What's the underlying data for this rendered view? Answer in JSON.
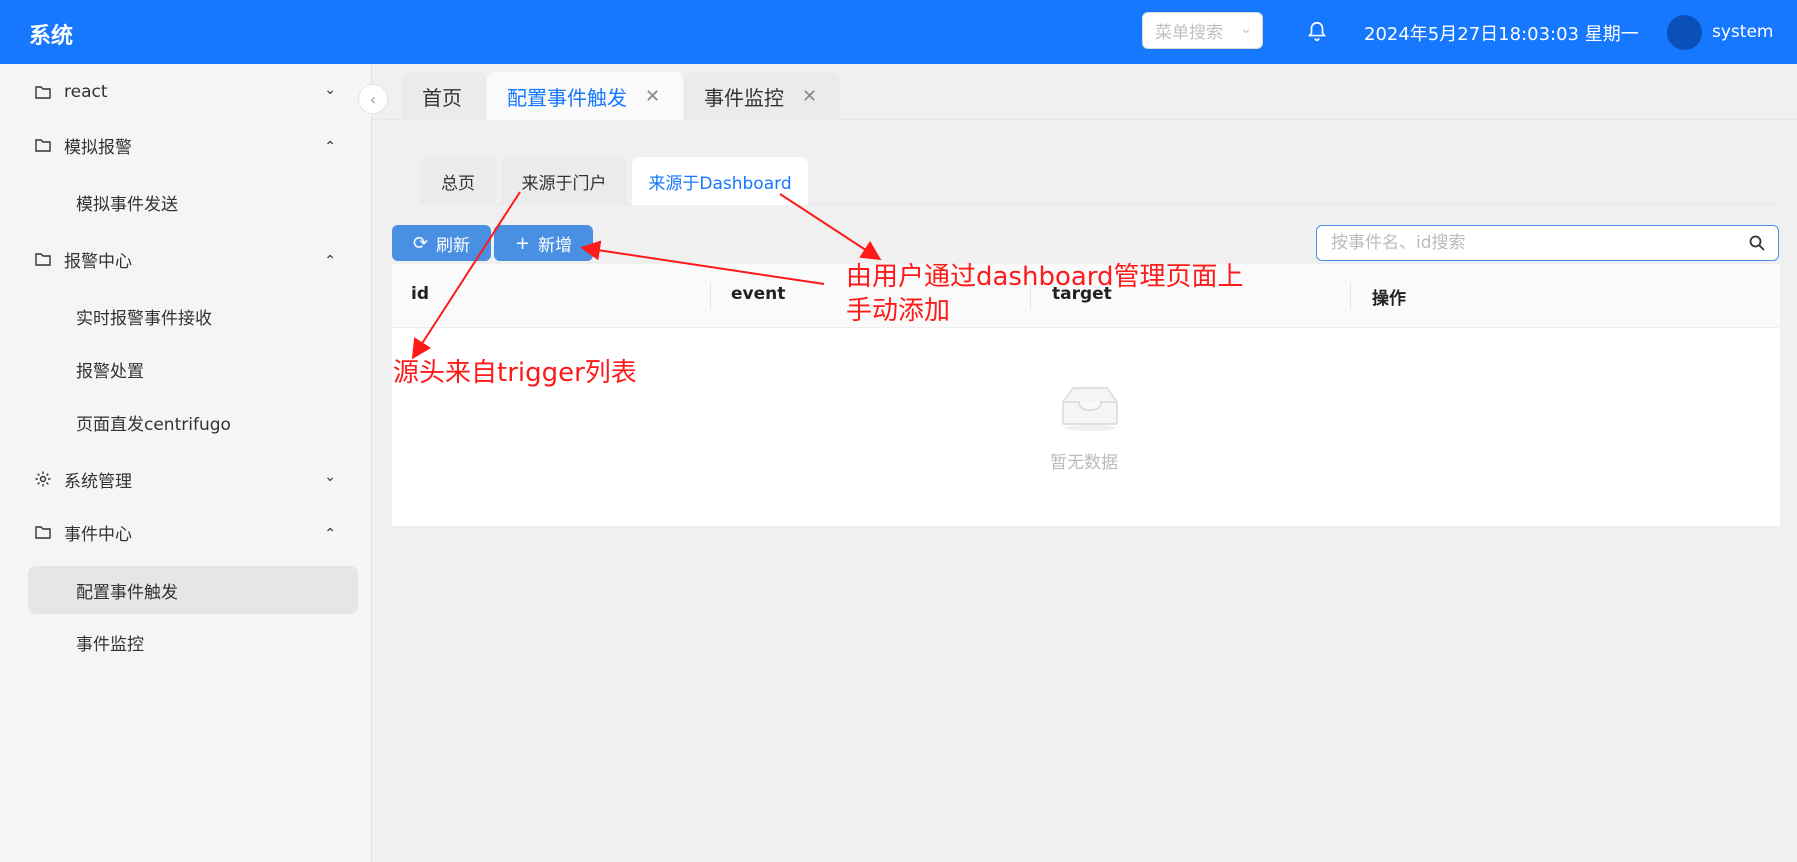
{
  "header": {
    "title": "系统",
    "menu_search_placeholder": "菜单搜索",
    "datetime": "2024年5月27日18:03:03 星期一",
    "username": "system",
    "accent_color": "#1677ff"
  },
  "sidebar": {
    "items": [
      {
        "label": "react",
        "icon": "folder-icon",
        "expanded": false
      },
      {
        "label": "模拟报警",
        "icon": "folder-icon",
        "expanded": true,
        "children": [
          "模拟事件发送"
        ]
      },
      {
        "label": "报警中心",
        "icon": "folder-icon",
        "expanded": true,
        "children": [
          "实时报警事件接收",
          "报警处置",
          "页面直发centrifugo"
        ]
      },
      {
        "label": "系统管理",
        "icon": "gear-icon",
        "expanded": false
      },
      {
        "label": "事件中心",
        "icon": "folder-icon",
        "expanded": true,
        "children": [
          "配置事件触发",
          "事件监控"
        ],
        "active_child": "配置事件触发"
      }
    ]
  },
  "tabs": [
    {
      "label": "首页",
      "closable": false
    },
    {
      "label": "配置事件触发",
      "closable": true,
      "active": true
    },
    {
      "label": "事件监控",
      "closable": true
    }
  ],
  "sub_tabs": [
    {
      "label": "总页"
    },
    {
      "label": "来源于门户"
    },
    {
      "label": "来源于Dashboard",
      "active": true
    }
  ],
  "toolbar": {
    "refresh_label": "刷新",
    "add_label": "新增",
    "search_placeholder": "按事件名、id搜索"
  },
  "table": {
    "columns": [
      "id",
      "event",
      "target",
      "操作"
    ],
    "rows": [],
    "empty_text": "暂无数据"
  },
  "annotations": {
    "dashboard_note": [
      "由用户通过dashboard管理页面上",
      "手动添加"
    ],
    "trigger_note": "源头来自trigger列表",
    "color": "#ff1a1a"
  }
}
